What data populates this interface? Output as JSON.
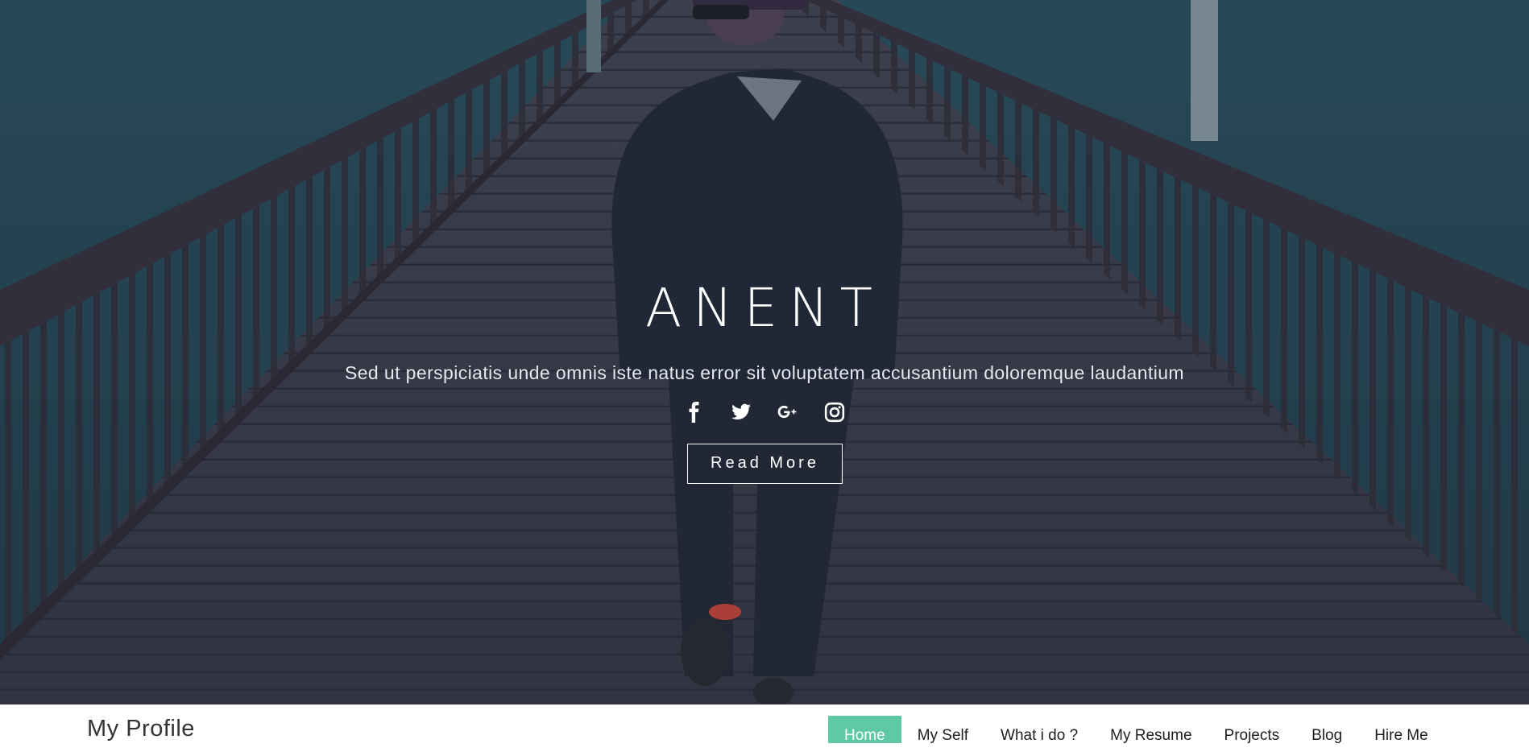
{
  "hero": {
    "title": "ANENT",
    "subtitle": "Sed ut perspiciatis unde omnis iste natus error sit voluptatem accusantium doloremque laudantium",
    "read_more_label": "Read More",
    "social": [
      {
        "name": "facebook",
        "icon": "facebook-icon"
      },
      {
        "name": "twitter",
        "icon": "twitter-icon"
      },
      {
        "name": "google-plus",
        "icon": "google-plus-icon"
      },
      {
        "name": "instagram",
        "icon": "instagram-icon"
      }
    ]
  },
  "navbar": {
    "brand": "My Profile",
    "items": [
      {
        "label": "Home",
        "active": true
      },
      {
        "label": "My Self",
        "active": false
      },
      {
        "label": "What i do ?",
        "active": false
      },
      {
        "label": "My Resume",
        "active": false
      },
      {
        "label": "Projects",
        "active": false
      },
      {
        "label": "Blog",
        "active": false
      },
      {
        "label": "Hire Me",
        "active": false
      }
    ]
  },
  "colors": {
    "accent": "#5fc9a6",
    "hero_overlay": "#2b3446",
    "text_light": "#ffffff"
  }
}
